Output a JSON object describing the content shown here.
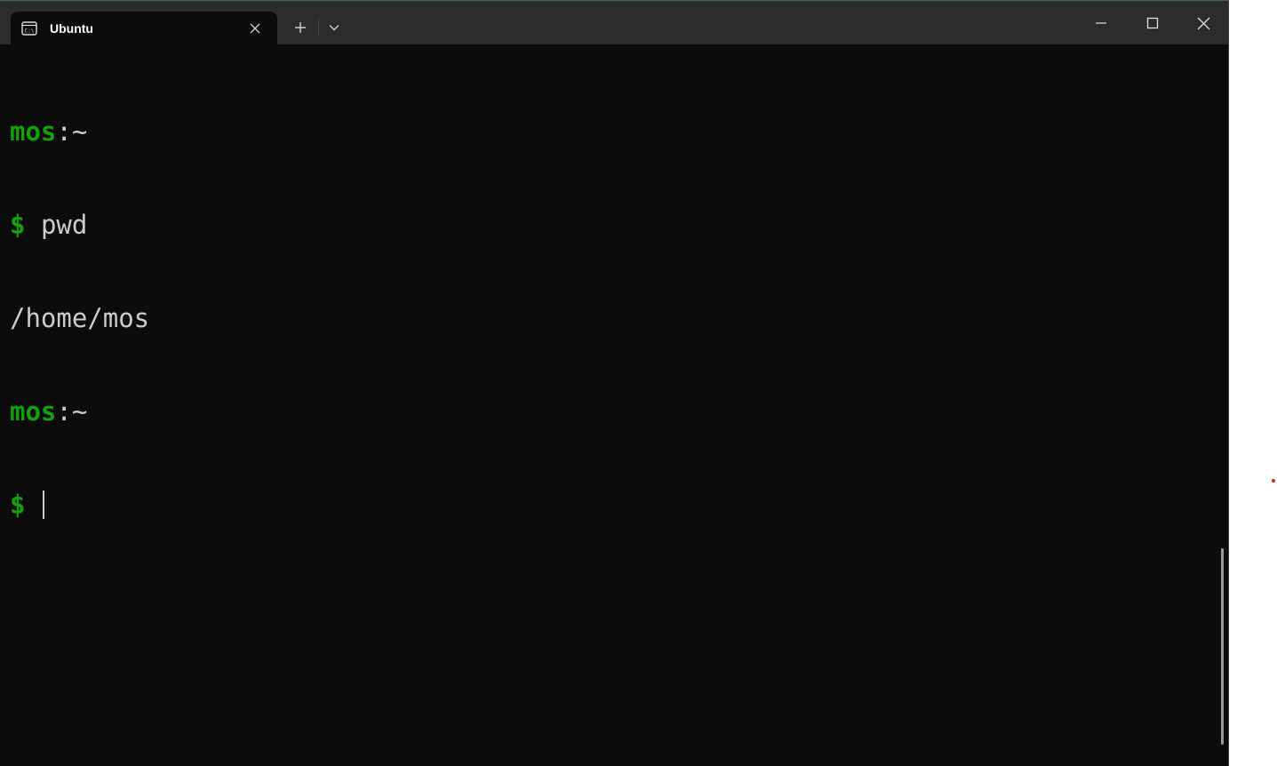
{
  "window": {
    "tab_title": "Ubuntu",
    "tab_icon": "terminal-icon",
    "controls": [
      "minimize-icon",
      "maximize-icon",
      "close-icon"
    ]
  },
  "terminal": {
    "lines": [
      {
        "user": "mos",
        "sep": ":~"
      },
      {
        "prompt": "$",
        "command": "pwd"
      },
      {
        "output": "/home/mos"
      },
      {
        "user": "mos",
        "sep": ":~"
      },
      {
        "prompt": "$",
        "command": ""
      }
    ]
  },
  "colors": {
    "terminal_bg": "#0c0c0c",
    "titlebar_bg": "#2c2c2c",
    "prompt_green": "#13a10e",
    "text": "#cccccc"
  }
}
